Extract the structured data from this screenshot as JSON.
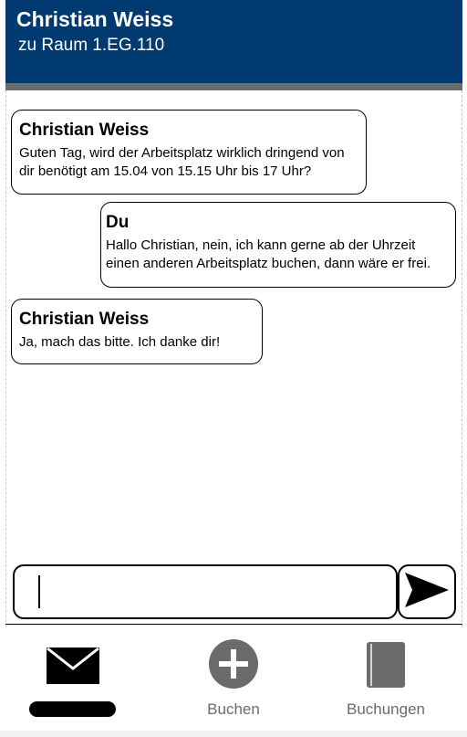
{
  "header": {
    "contact_name": "Christian Weiss",
    "room": "zu Raum 1.EG.110",
    "background_color": "#003a70"
  },
  "messages": [
    {
      "sender": "Christian Weiss",
      "text": "Guten Tag, wird der Arbeitsplatz wirklich dringend von dir benötigt am 15.04 von 15.15 Uhr bis 17 Uhr?",
      "direction": "incoming"
    },
    {
      "sender": "Du",
      "text": "Hallo Christian, nein, ich kann gerne ab der Uhrzeit einen anderen Arbeitsplatz buchen, dann wäre er frei.",
      "direction": "outgoing"
    },
    {
      "sender": "Christian Weiss",
      "text": "Ja, mach das bitte. Ich danke dir!",
      "direction": "incoming"
    }
  ],
  "composer": {
    "value": "",
    "send_icon": "send-arrow-icon"
  },
  "nav": {
    "items": [
      {
        "icon": "envelope-icon",
        "label": "",
        "active": true
      },
      {
        "icon": "plus-circle-icon",
        "label": "Buchen",
        "active": false
      },
      {
        "icon": "book-icon",
        "label": "Buchungen",
        "active": false
      }
    ],
    "label_color": "#6b6b6b"
  }
}
